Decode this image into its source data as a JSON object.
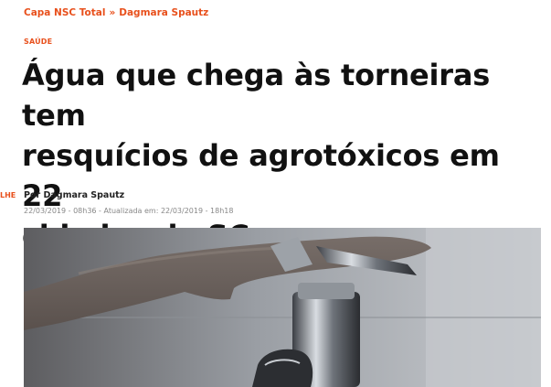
{
  "breadcrumb": {
    "home": "Capa NSC Total",
    "separator": "»",
    "author": "Dagmara Spautz"
  },
  "article": {
    "section": "SAÚDE",
    "title_lines": [
      "Água que chega às torneiras tem",
      "resquícios de agrotóxicos em 22",
      "cidades de SC"
    ],
    "byline": "Por Dagmara Spautz",
    "dates": "22/03/2019 - 08h36 - Atualizada em: 22/03/2019 - 18h18"
  },
  "sidebar": {
    "cut_label": "LHE"
  },
  "photo": {
    "subject": "hand-opening-faucet"
  }
}
